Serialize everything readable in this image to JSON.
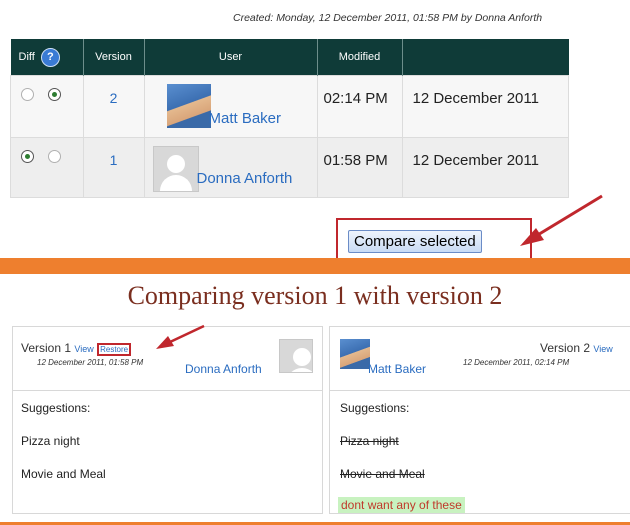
{
  "created_line": "Created: Monday, 12 December 2011, 01:58 PM by Donna Anforth",
  "history": {
    "headers": {
      "diff": "Diff",
      "help": "?",
      "version": "Version",
      "user": "User",
      "modified": "Modified",
      "date": ""
    },
    "rows": [
      {
        "version": "2",
        "user": "Matt Baker",
        "time": "02:14 PM",
        "date": "12 December 2011",
        "radio_left": false,
        "radio_right": true
      },
      {
        "version": "1",
        "user": "Donna Anforth",
        "time": "01:58 PM",
        "date": "12 December 2011",
        "radio_left": true,
        "radio_right": false
      }
    ]
  },
  "compare_button": "Compare selected",
  "comparison": {
    "heading": "Comparing version 1 with version 2",
    "left": {
      "version_label": "Version 1",
      "view": "View",
      "restore": "Restore",
      "timestamp": "12 December 2011, 01:58 PM",
      "user": "Donna Anforth",
      "section": "Suggestions:",
      "items": [
        "Pizza night",
        "Movie and Meal"
      ]
    },
    "right": {
      "version_label": "Version 2",
      "view": "View",
      "timestamp": "12 December 2011, 02:14 PM",
      "user": "Matt Baker",
      "section": "Suggestions:",
      "removed": [
        "Pizza night",
        "Movie and Meal"
      ],
      "added": "dont want any of these"
    }
  },
  "colors": {
    "header_bg": "#0f3b38",
    "link": "#2a6cc0",
    "accent_orange": "#ee7f2e",
    "annotation_red": "#c0272d"
  }
}
